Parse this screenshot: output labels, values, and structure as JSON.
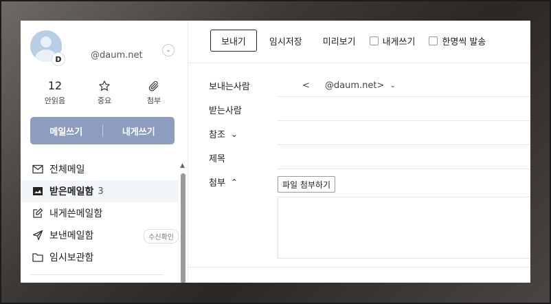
{
  "account": {
    "avatar_badge": "D",
    "email": "@daum.net"
  },
  "stats": [
    {
      "value": "12",
      "label": "안읽음"
    },
    {
      "icon": "star-icon",
      "label": "중요"
    },
    {
      "icon": "paperclip-icon",
      "label": "첨부"
    }
  ],
  "compose": {
    "write_mail": "메일쓰기",
    "write_to_me": "내게쓰기"
  },
  "folders": [
    {
      "icon": "mail-icon",
      "label": "전체메일"
    },
    {
      "icon": "inbox-icon",
      "label": "받은메일함",
      "count": "3",
      "active": true
    },
    {
      "icon": "edit-icon",
      "label": "내게쓴메일함"
    },
    {
      "icon": "send-icon",
      "label": "보낸메일함",
      "pill": "수신확인"
    },
    {
      "icon": "folder-icon",
      "label": "임시보관함"
    }
  ],
  "toolbar": {
    "send": "보내기",
    "save_draft": "임시저장",
    "preview": "미리보기",
    "write_to_me": "내게쓰기",
    "send_individually": "한명씩 발송"
  },
  "form": {
    "sender_label": "보내는사람",
    "sender_prefix": "<",
    "sender_email": "@daum.net>",
    "recipient_label": "받는사람",
    "cc_label": "참조",
    "subject_label": "제목",
    "attach_label": "첨부",
    "attach_button": "파일 첨부하기"
  },
  "colors": {
    "compose_button": "#8e9dbf",
    "active_folder_bg": "#f2f5fa"
  }
}
